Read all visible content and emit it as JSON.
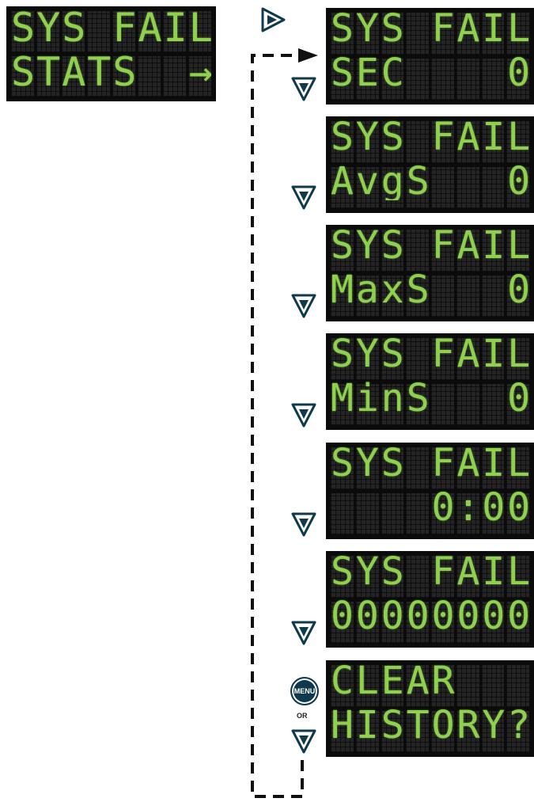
{
  "start_screen": {
    "line1": "SYS FAIL",
    "line2": "STATS  →"
  },
  "screens": [
    {
      "line1": "SYS FAIL",
      "line2": "SEC    0"
    },
    {
      "line1": "SYS FAIL",
      "line2": "AvgS   0"
    },
    {
      "line1": "SYS FAIL",
      "line2": "MaxS   0"
    },
    {
      "line1": "SYS FAIL",
      "line2": "MinS   0"
    },
    {
      "line1": "SYS FAIL",
      "line2": "    0:00"
    },
    {
      "line1": "SYS FAIL",
      "line2": "00000000"
    },
    {
      "line1": "CLEAR",
      "line2": "HISTORY?"
    }
  ],
  "buttons": {
    "right": "right-arrow-button",
    "down": "down-arrow-button",
    "menu_label": "MENU",
    "or_label": "OR"
  },
  "colors": {
    "lcd_text": "#8fd14f",
    "lcd_bg": "#0b0b0b",
    "button_fill": "#0f3a4e"
  }
}
